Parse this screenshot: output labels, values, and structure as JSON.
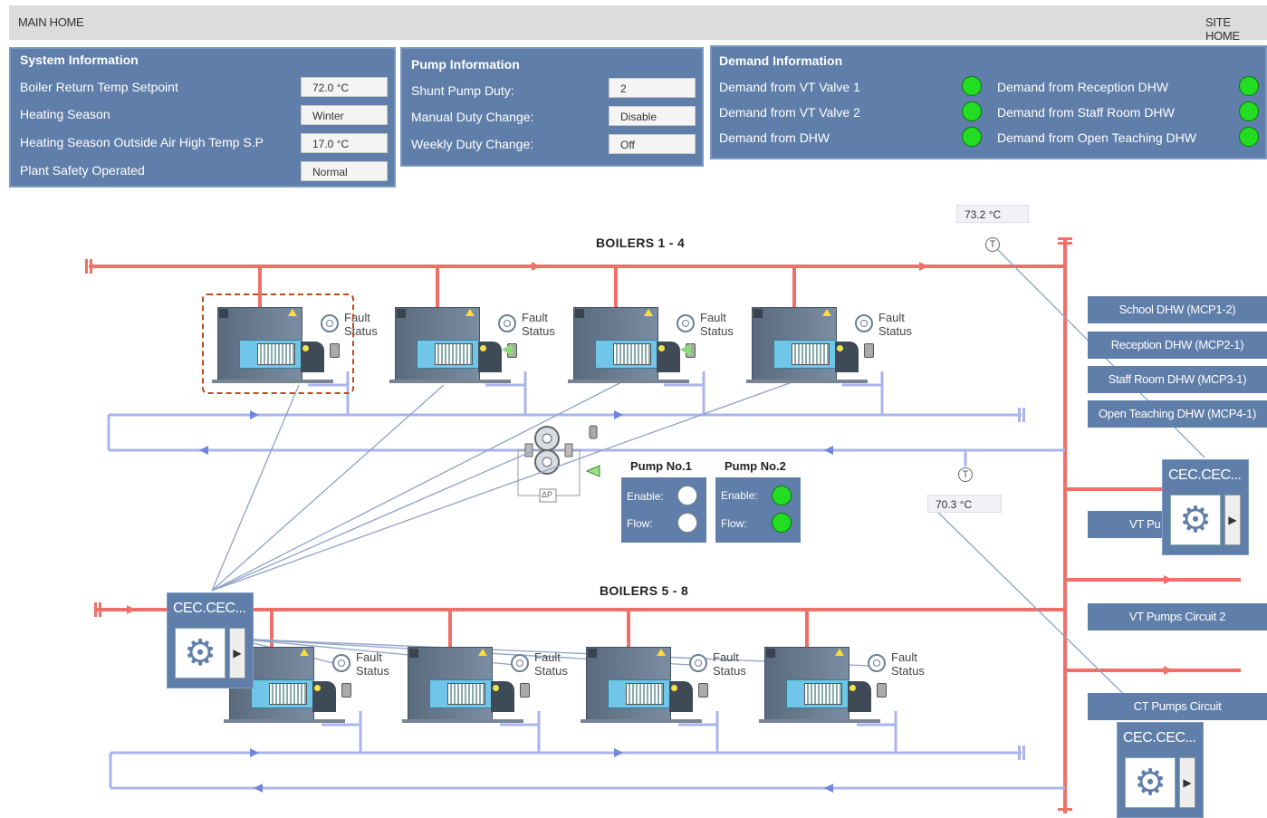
{
  "topbar": {
    "main_home": "MAIN HOME",
    "site_home": "SITE HOME"
  },
  "system_info": {
    "title": "System Information",
    "rows": [
      {
        "label": "Boiler Return Temp Setpoint",
        "value": "72.0 °C"
      },
      {
        "label": "Heating Season",
        "value": "Winter"
      },
      {
        "label": "Heating Season Outside Air High Temp S.P",
        "value": "17.0 °C"
      },
      {
        "label": "Plant Safety Operated",
        "value": "Normal"
      }
    ]
  },
  "pump_info": {
    "title": "Pump Information",
    "rows": [
      {
        "label": "Shunt Pump Duty:",
        "value": "2"
      },
      {
        "label": "Manual Duty Change:",
        "value": "Disable"
      },
      {
        "label": "Weekly Duty Change:",
        "value": "Off"
      }
    ]
  },
  "demand_info": {
    "title": "Demand Information",
    "left": [
      {
        "label": "Demand from VT Valve 1",
        "status": "on"
      },
      {
        "label": "Demand from VT Valve 2",
        "status": "on"
      },
      {
        "label": "Demand from DHW",
        "status": "on"
      }
    ],
    "right": [
      {
        "label": "Demand from Reception DHW",
        "status": "on"
      },
      {
        "label": "Demand from Staff Room DHW",
        "status": "on"
      },
      {
        "label": "Demand from Open Teaching DHW",
        "status": "on"
      }
    ]
  },
  "boilers_1_4": {
    "title": "BOILERS 1 - 4"
  },
  "boilers_5_8": {
    "title": "BOILERS 5 - 8"
  },
  "fault_label": {
    "line1": "Fault",
    "line2": "Status"
  },
  "temps": {
    "flow": "73.2 °C",
    "return": "70.3 °C"
  },
  "temp_marker": "T",
  "dp_label": "ΔP",
  "pumps": [
    {
      "name": "Pump No.1",
      "enable_label": "Enable:",
      "flow_label": "Flow:",
      "enable": "off",
      "flow": "off"
    },
    {
      "name": "Pump No.2",
      "enable_label": "Enable:",
      "flow_label": "Flow:",
      "enable": "on",
      "flow": "on"
    }
  ],
  "circuits": {
    "school_dhw": "School DHW (MCP1-2)",
    "reception_dhw": "Reception DHW (MCP2-1)",
    "staff_room_dhw": "Staff Room DHW (MCP3-1)",
    "open_teaching_dhw": "Open Teaching DHW (MCP4-1)",
    "vt_pumps_1": "VT Pu",
    "vt_pumps_2": "VT Pumps Circuit 2",
    "ct_pumps": "CT Pumps Circuit"
  },
  "controllers": [
    {
      "name": "CEC.CEC..."
    },
    {
      "name": "CEC.CEC..."
    },
    {
      "name": "CEC.CEC..."
    }
  ],
  "colors": {
    "panel": "#5f7ea9",
    "flow_pipe": "#f07068",
    "return_pipe": "#a9b4ee",
    "led_on": "#22dd22",
    "led_off": "#ffffff"
  }
}
